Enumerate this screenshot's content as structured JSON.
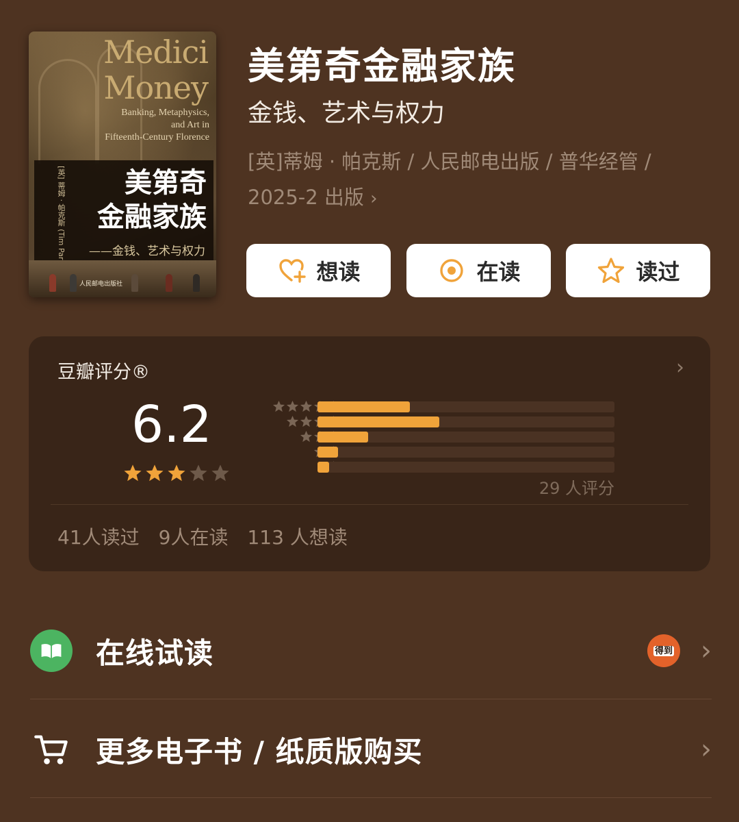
{
  "book": {
    "title": "美第奇金融家族",
    "subtitle": "金钱、艺术与权力",
    "meta_line1": "[英]蒂姆 · 帕克斯 / 人民邮电出版 / 普华经管 /",
    "meta_line2": "2025-2 出版"
  },
  "cover": {
    "en_title_1": "Medici",
    "en_title_2": "Money",
    "en_sub_1": "Banking, Metaphysics,",
    "en_sub_2": "and Art in",
    "en_sub_3": "Fifteenth-Century Florence",
    "cn_title_1": "美第奇",
    "cn_title_2": "金融家族",
    "cn_sub": "——金钱、艺术与权力",
    "author_vertical": "[英] 蒂姆 · 帕克斯 (Tim Parks) 著",
    "publisher": "人民邮电出版社"
  },
  "actions": {
    "want_label": "想读",
    "reading_label": "在读",
    "read_label": "读过",
    "accent_color": "#f0a33a"
  },
  "rating": {
    "label": "豆瓣评分®",
    "score": "6.2",
    "score_stars": 3,
    "distribution": [
      0.31,
      0.41,
      0.17,
      0.07,
      0.04
    ],
    "count_label": "29 人评分",
    "stats": {
      "read": "41人读过",
      "reading": "9人在读",
      "want": "113 人想读"
    }
  },
  "list": {
    "online_read": "在线试读",
    "dedao_badge": "得到",
    "buy": "更多电子书 / 纸质版购买"
  }
}
